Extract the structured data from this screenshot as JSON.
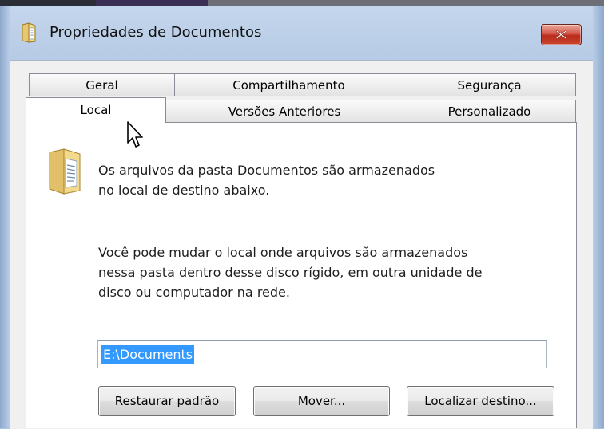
{
  "window": {
    "title": "Propriedades de Documentos"
  },
  "tabs_row1": [
    {
      "label": "Geral"
    },
    {
      "label": "Compartilhamento"
    },
    {
      "label": "Segurança"
    }
  ],
  "tabs_row2": [
    {
      "label": "Local",
      "selected": true
    },
    {
      "label": "Versões Anteriores"
    },
    {
      "label": "Personalizado"
    }
  ],
  "local": {
    "intro_line1": "Os arquivos da pasta Documentos são armazenados",
    "intro_line2": "no local de destino abaixo.",
    "info_line1": "Você pode mudar o local onde arquivos são armazenados",
    "info_line2": "nessa pasta dentro desse disco rígido, em outra unidade de",
    "info_line3": "disco ou computador na rede.",
    "path_value": "E:\\Documents",
    "restore_label": "Restaurar padrão",
    "move_label": "Mover...",
    "find_label": "Localizar destino..."
  },
  "icons": {
    "app": "folder-properties-icon",
    "close": "close-icon",
    "folder": "documents-folder-icon",
    "cursor": "mouse-pointer-icon"
  },
  "colors": {
    "selection": "#3399ff",
    "close_red": "#c9462f",
    "frame_blue": "#b7cbe6"
  }
}
